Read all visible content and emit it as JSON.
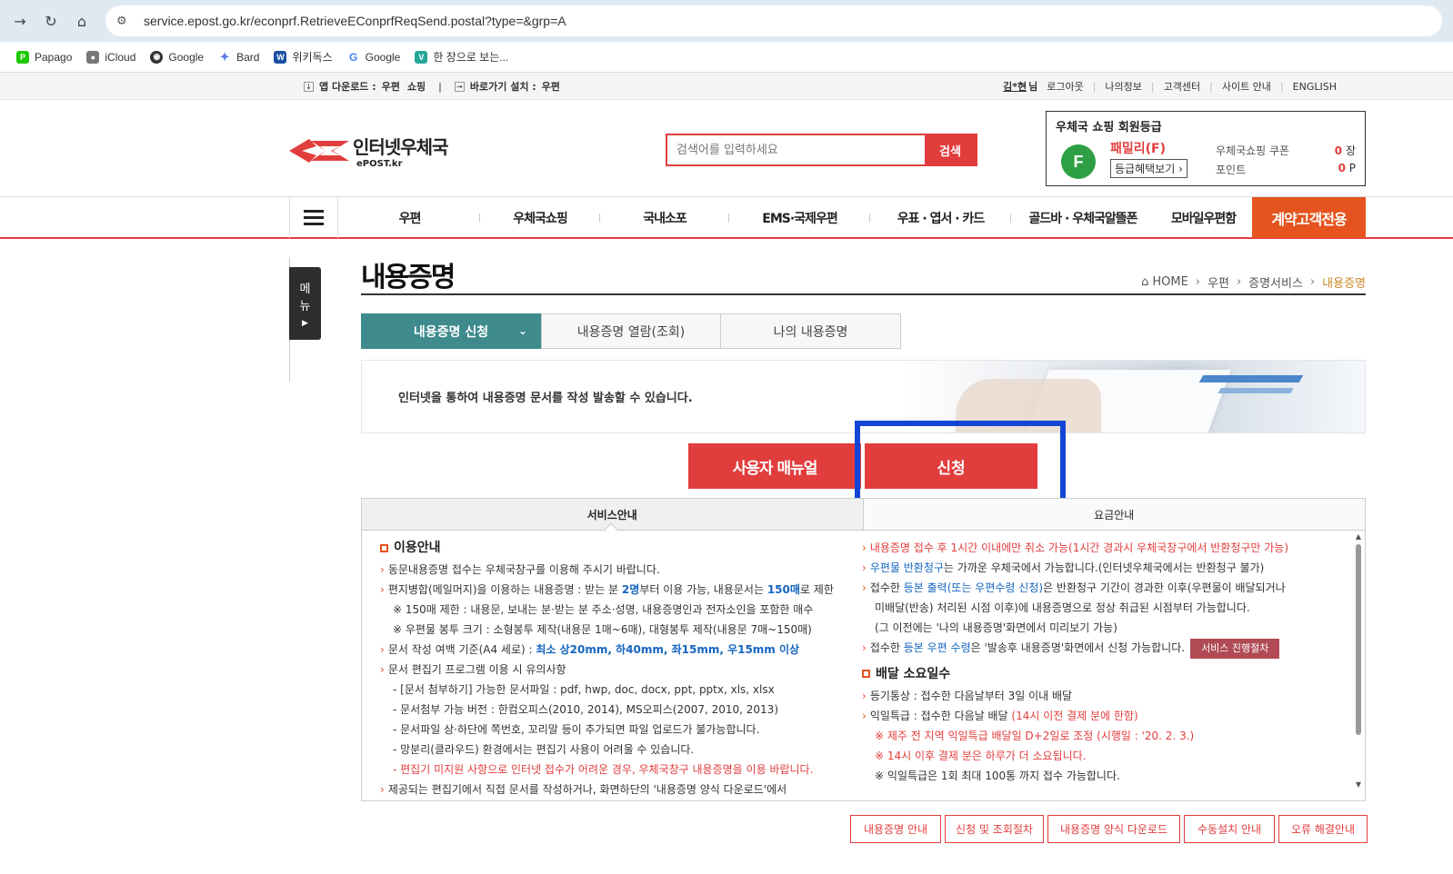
{
  "browser": {
    "url": "service.epost.go.kr/econprf.RetrieveEConprfReqSend.postal?type=&grp=A",
    "bookmarks": [
      "Papago",
      "iCloud",
      "Google",
      "Bard",
      "위키독스",
      "Google",
      "한 장으로 보는..."
    ]
  },
  "util": {
    "app_download": "앱 다운로드 :",
    "app_post": "우편",
    "app_shop": "쇼핑",
    "shortcut": "바로가기 설치 :",
    "shortcut_post": "우편",
    "user_name": "김*현",
    "user_suffix": "님",
    "links": [
      "로그아웃",
      "나의정보",
      "고객센터",
      "사이트 안내",
      "ENGLISH"
    ]
  },
  "header": {
    "logo_ko": "인터넷우체국",
    "logo_en": "ePOST.kr",
    "search_placeholder": "검색어를 입력하세요",
    "search_button": "검색",
    "member": {
      "title": "우체국 쇼핑 회원등급",
      "badge": "F",
      "grade": "패밀리(F)",
      "benefit": "등급혜택보기",
      "coupon_label": "우체국쇼핑 쿠폰",
      "coupon_value": "0",
      "coupon_unit": "장",
      "point_label": "포인트",
      "point_value": "0",
      "point_unit": "P"
    }
  },
  "gnb": {
    "items": [
      "우편",
      "우체국쇼핑",
      "국내소포",
      "EMS·국제우편",
      "우표 · 엽서 · 카드",
      "골드바 · 우체국알뜰폰",
      "모바일우편함"
    ],
    "special": "계약고객전용"
  },
  "side": {
    "label1": "메",
    "label2": "뉴"
  },
  "page": {
    "title": "내용증명",
    "breadcrumb": [
      "HOME",
      "우편",
      "증명서비스",
      "내용증명"
    ],
    "tabs": [
      "내용증명 신청",
      "내용증명 열람(조회)",
      "나의 내용증명"
    ],
    "intro": "인터넷을 통하여 내용증명 문서를 작성 발송할 수 있습니다.",
    "btn_manual": "사용자 매뉴얼",
    "btn_apply": "신청",
    "svc_tabs": [
      "서비스안내",
      "요금안내"
    ]
  },
  "left_col": {
    "heading": "이용안내",
    "l1": "동문내용증명 접수는 우체국창구를 이용해 주시기 바랍니다.",
    "l2a": "편지병합(메일머지)을 이용하는 내용증명 : 받는 분 ",
    "l2b": "2명",
    "l2c": "부터 이용 가능, 내용문서는 ",
    "l2d": "150매",
    "l2e": "로 제한",
    "l3": "※ 150매 제한 : 내용문, 보내는 분·받는 분 주소·성명, 내용증명인과 전자소인을 포함한 매수",
    "l4": "※ 우편물 봉투 크기 : 소형봉투 제작(내용문 1매~6매), 대형봉투 제작(내용문 7매~150매)",
    "l5a": "문서 작성 여백 기준(A4 세로) : ",
    "l5b": "최소 상20mm, 하40mm, 좌15mm, 우15mm 이상",
    "l6": "문서 편집기 프로그램 이용 시 유의사항",
    "l7": "- [문서 첨부하기] 가능한 문서파일 : pdf, hwp, doc, docx, ppt, pptx, xls, xlsx",
    "l8": "- 문서첨부 가능 버전 : 한컴오피스(2010, 2014), MS오피스(2007, 2010, 2013)",
    "l9": "- 문서파일 상·하단에 쪽번호, 꼬리말 등이 추가되면 파일 업로드가 불가능합니다.",
    "l10": "- 망분리(클라우드) 환경에서는 편집기 사용이 어려울 수 있습니다.",
    "l11": "- 편집기 미지원 사항으로 인터넷 접수가 어려운 경우, 우체국창구 내용증명을 이용 바랍니다.",
    "l12": "제공되는 편집기에서 직접 문서를 작성하거나, 화면하단의 '내용증명 양식 다운로드'에서"
  },
  "right_col": {
    "r1": "내용증명 접수 후 1시간 이내에만 취소 가능(1시간 경과시 우체국창구에서 반환청구만 가능)",
    "r2a": "우편물 반환청구",
    "r2b": "는 가까운 우체국에서 가능합니다.(인터넷우체국에서는 반환청구 불가)",
    "r3a": "접수한 ",
    "r3b": "등본 출력(또는 우편수령 신청)",
    "r3c": "은 반환청구 기간이 경과한 이후(우편물이 배달되거나",
    "r4": "미배달(반송) 처리된 시점 이후)에 내용증명으로 정상 취급된 시점부터 가능합니다.",
    "r5": "(그 이전에는 '나의 내용증명'화면에서 미리보기 가능)",
    "r6a": "접수한 ",
    "r6b": "등본 우편 수령",
    "r6c": "은 '발송후 내용증명'화면에서 신청 가능합니다.",
    "r6btn": "서비스 진행절차",
    "heading": "배달 소요일수",
    "r7": "등기통상 : 접수한 다음날부터 3일 이내 배달",
    "r8a": "익일특급 : 접수한 다음날 배달 ",
    "r8b": "(14시 이전 결제 분에 한함)",
    "r9": "※ 제주 전 지역 익일특급 배달일 D+2일로 조정 (시행일 : '20. 2. 3.)",
    "r10": "※ 14시 이후 결제 분은 하루가 더 소요됩니다.",
    "r11": "※ 익일특급은 1회 최대 100통 까지 접수 가능합니다."
  },
  "bottom_buttons": [
    "내용증명 안내",
    "신청 및 조회절차",
    "내용증명 양식 다운로드",
    "수동설치 안내",
    "오류 해결안내"
  ]
}
